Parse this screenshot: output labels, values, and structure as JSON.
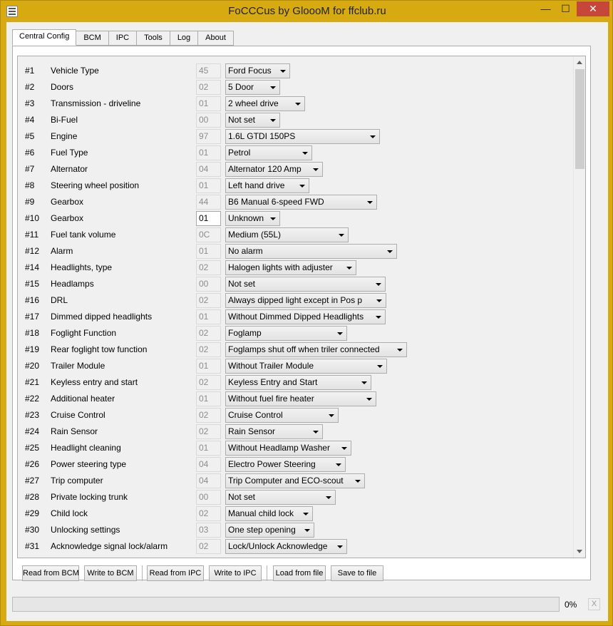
{
  "window": {
    "title": "FoCCCus by GloooM for ffclub.ru",
    "minimize_glyph": "—",
    "maximize_glyph": "☐",
    "close_glyph": "✕"
  },
  "tabs": [
    "Central Config",
    "BCM",
    "IPC",
    "Tools",
    "Log",
    "About"
  ],
  "active_tab": "Central Config",
  "rows": [
    {
      "num": "#1",
      "label": "Vehicle Type",
      "code": "45",
      "value": "Ford Focus"
    },
    {
      "num": "#2",
      "label": "Doors",
      "code": "02",
      "value": "5 Door"
    },
    {
      "num": "#3",
      "label": "Transmission - driveline",
      "code": "01",
      "value": "2 wheel drive"
    },
    {
      "num": "#4",
      "label": "Bi-Fuel",
      "code": "00",
      "value": "Not set"
    },
    {
      "num": "#5",
      "label": "Engine",
      "code": "97",
      "value": "1.6L GTDI 150PS"
    },
    {
      "num": "#6",
      "label": "Fuel Type",
      "code": "01",
      "value": "Petrol"
    },
    {
      "num": "#7",
      "label": "Alternator",
      "code": "04",
      "value": "Alternator 120 Amp"
    },
    {
      "num": "#8",
      "label": "Steering wheel position",
      "code": "01",
      "value": "Left hand drive"
    },
    {
      "num": "#9",
      "label": "Gearbox",
      "code": "44",
      "value": "B6 Manual 6-speed FWD"
    },
    {
      "num": "#10",
      "label": "Gearbox",
      "code": "01",
      "value": "Unknown"
    },
    {
      "num": "#11",
      "label": "Fuel tank volume",
      "code": "0C",
      "value": "Medium (55L)"
    },
    {
      "num": "#12",
      "label": "Alarm",
      "code": "01",
      "value": "No alarm"
    },
    {
      "num": "#14",
      "label": "Headlights, type",
      "code": "02",
      "value": "Halogen lights with adjuster"
    },
    {
      "num": "#15",
      "label": "Headlamps",
      "code": "00",
      "value": "Not set"
    },
    {
      "num": "#16",
      "label": "DRL",
      "code": "02",
      "value": "Always dipped light except in Pos p"
    },
    {
      "num": "#17",
      "label": "Dimmed dipped headlights",
      "code": "01",
      "value": "Without Dimmed Dipped Headlights"
    },
    {
      "num": "#18",
      "label": "Foglight Function",
      "code": "02",
      "value": "Foglamp"
    },
    {
      "num": "#19",
      "label": "Rear foglight tow function",
      "code": "02",
      "value": "Foglamps shut off when triler connected"
    },
    {
      "num": "#20",
      "label": "Trailer Module",
      "code": "01",
      "value": "Without Trailer Module"
    },
    {
      "num": "#21",
      "label": "Keyless entry and start",
      "code": "02",
      "value": "Keyless Entry and Start"
    },
    {
      "num": "#22",
      "label": "Additional heater",
      "code": "01",
      "value": "Without fuel fire heater"
    },
    {
      "num": "#23",
      "label": "Cruise Control",
      "code": "02",
      "value": "Cruise Control"
    },
    {
      "num": "#24",
      "label": "Rain Sensor",
      "code": "02",
      "value": "Rain Sensor"
    },
    {
      "num": "#25",
      "label": "Headlight cleaning",
      "code": "01",
      "value": "Without Headlamp Washer"
    },
    {
      "num": "#26",
      "label": "Power steering type",
      "code": "04",
      "value": "Electro Power Steering"
    },
    {
      "num": "#27",
      "label": "Trip computer",
      "code": "04",
      "value": "Trip Computer and ECO-scout"
    },
    {
      "num": "#28",
      "label": "Private locking trunk",
      "code": "00",
      "value": "Not set"
    },
    {
      "num": "#29",
      "label": "Child lock",
      "code": "02",
      "value": "Manual child lock"
    },
    {
      "num": "#30",
      "label": "Unlocking settings",
      "code": "03",
      "value": "One step opening"
    },
    {
      "num": "#31",
      "label": "Acknowledge signal lock/alarm",
      "code": "02",
      "value": "Lock/Unlock Acknowledge"
    }
  ],
  "buttons": {
    "read_bcm": "Read from BCM",
    "write_bcm": "Write to BCM",
    "read_ipc": "Read from IPC",
    "write_ipc": "Write to IPC",
    "load_file": "Load from file",
    "save_file": "Save to file"
  },
  "status": {
    "progress_value": 0,
    "progress_text": "0%",
    "cancel_glyph": "X"
  }
}
